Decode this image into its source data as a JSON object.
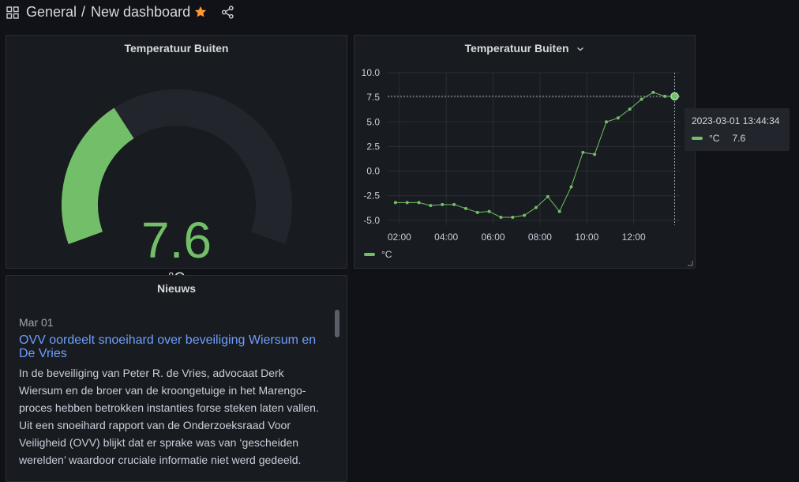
{
  "breadcrumb": {
    "folder": "General",
    "separator": "/",
    "dashboard": "New dashboard"
  },
  "icons": {
    "apps": "grid-icon",
    "favorite": "star-icon",
    "share": "share-icon",
    "menu": "chevron-down-icon",
    "resize": "resize-handle-icon"
  },
  "colors": {
    "accent": "#73bf69",
    "star": "#ff9830",
    "link": "#6e9fff",
    "background": "#111217",
    "panel": "#181b1f"
  },
  "gauge_panel": {
    "title": "Temperatuur Buiten",
    "value": "7.6",
    "unit": "°C",
    "min": -10,
    "max": 40,
    "fraction": 0.35
  },
  "chart_panel": {
    "title": "Temperatuur Buiten",
    "legend_label": "°C",
    "tooltip": {
      "time": "2023-03-01 13:44:34",
      "series": "°C",
      "value": "7.6"
    }
  },
  "chart_data": {
    "type": "line",
    "yticks": [
      "10.0",
      "7.5",
      "5.0",
      "2.5",
      "0.0",
      "-2.5",
      "-5.0"
    ],
    "xticks": [
      "02:00",
      "04:00",
      "06:00",
      "08:00",
      "10:00",
      "12:00"
    ],
    "ylim": [
      -5.5,
      10
    ],
    "xlim": [
      1.5,
      14.0
    ],
    "grid": true,
    "legend": "bottom-left",
    "series": [
      {
        "name": "°C",
        "x": [
          1.833,
          2.333,
          2.833,
          3.333,
          3.833,
          4.333,
          4.833,
          5.333,
          5.833,
          6.333,
          6.833,
          7.333,
          7.833,
          8.333,
          8.833,
          9.333,
          9.833,
          10.333,
          10.833,
          11.333,
          11.833,
          12.333,
          12.833,
          13.333,
          13.746
        ],
        "y": [
          -3.2,
          -3.2,
          -3.2,
          -3.5,
          -3.4,
          -3.4,
          -3.8,
          -4.2,
          -4.1,
          -4.7,
          -4.7,
          -4.5,
          -3.7,
          -2.6,
          -4.1,
          -1.6,
          1.9,
          1.7,
          5.0,
          5.4,
          6.3,
          7.3,
          8.0,
          7.6,
          7.6
        ]
      }
    ],
    "crosshair": {
      "x": 13.746,
      "y": 7.6
    }
  },
  "news_panel": {
    "title": "Nieuws",
    "items": [
      {
        "date": "Mar 01",
        "title": "OVV oordeelt snoeihard over beveiliging Wiersum en De Vries",
        "body": "In de beveiliging van Peter R. de Vries, advocaat Derk Wiersum en de broer van de kroongetuige in het Marengo-proces hebben betrokken instanties forse steken laten vallen. Uit een snoeihard rapport van de Onderzoeksraad Voor Veiligheid (OVV) blijkt dat er sprake was van ‘gescheiden werelden’ waardoor cruciale informatie niet werd gedeeld."
      }
    ]
  }
}
